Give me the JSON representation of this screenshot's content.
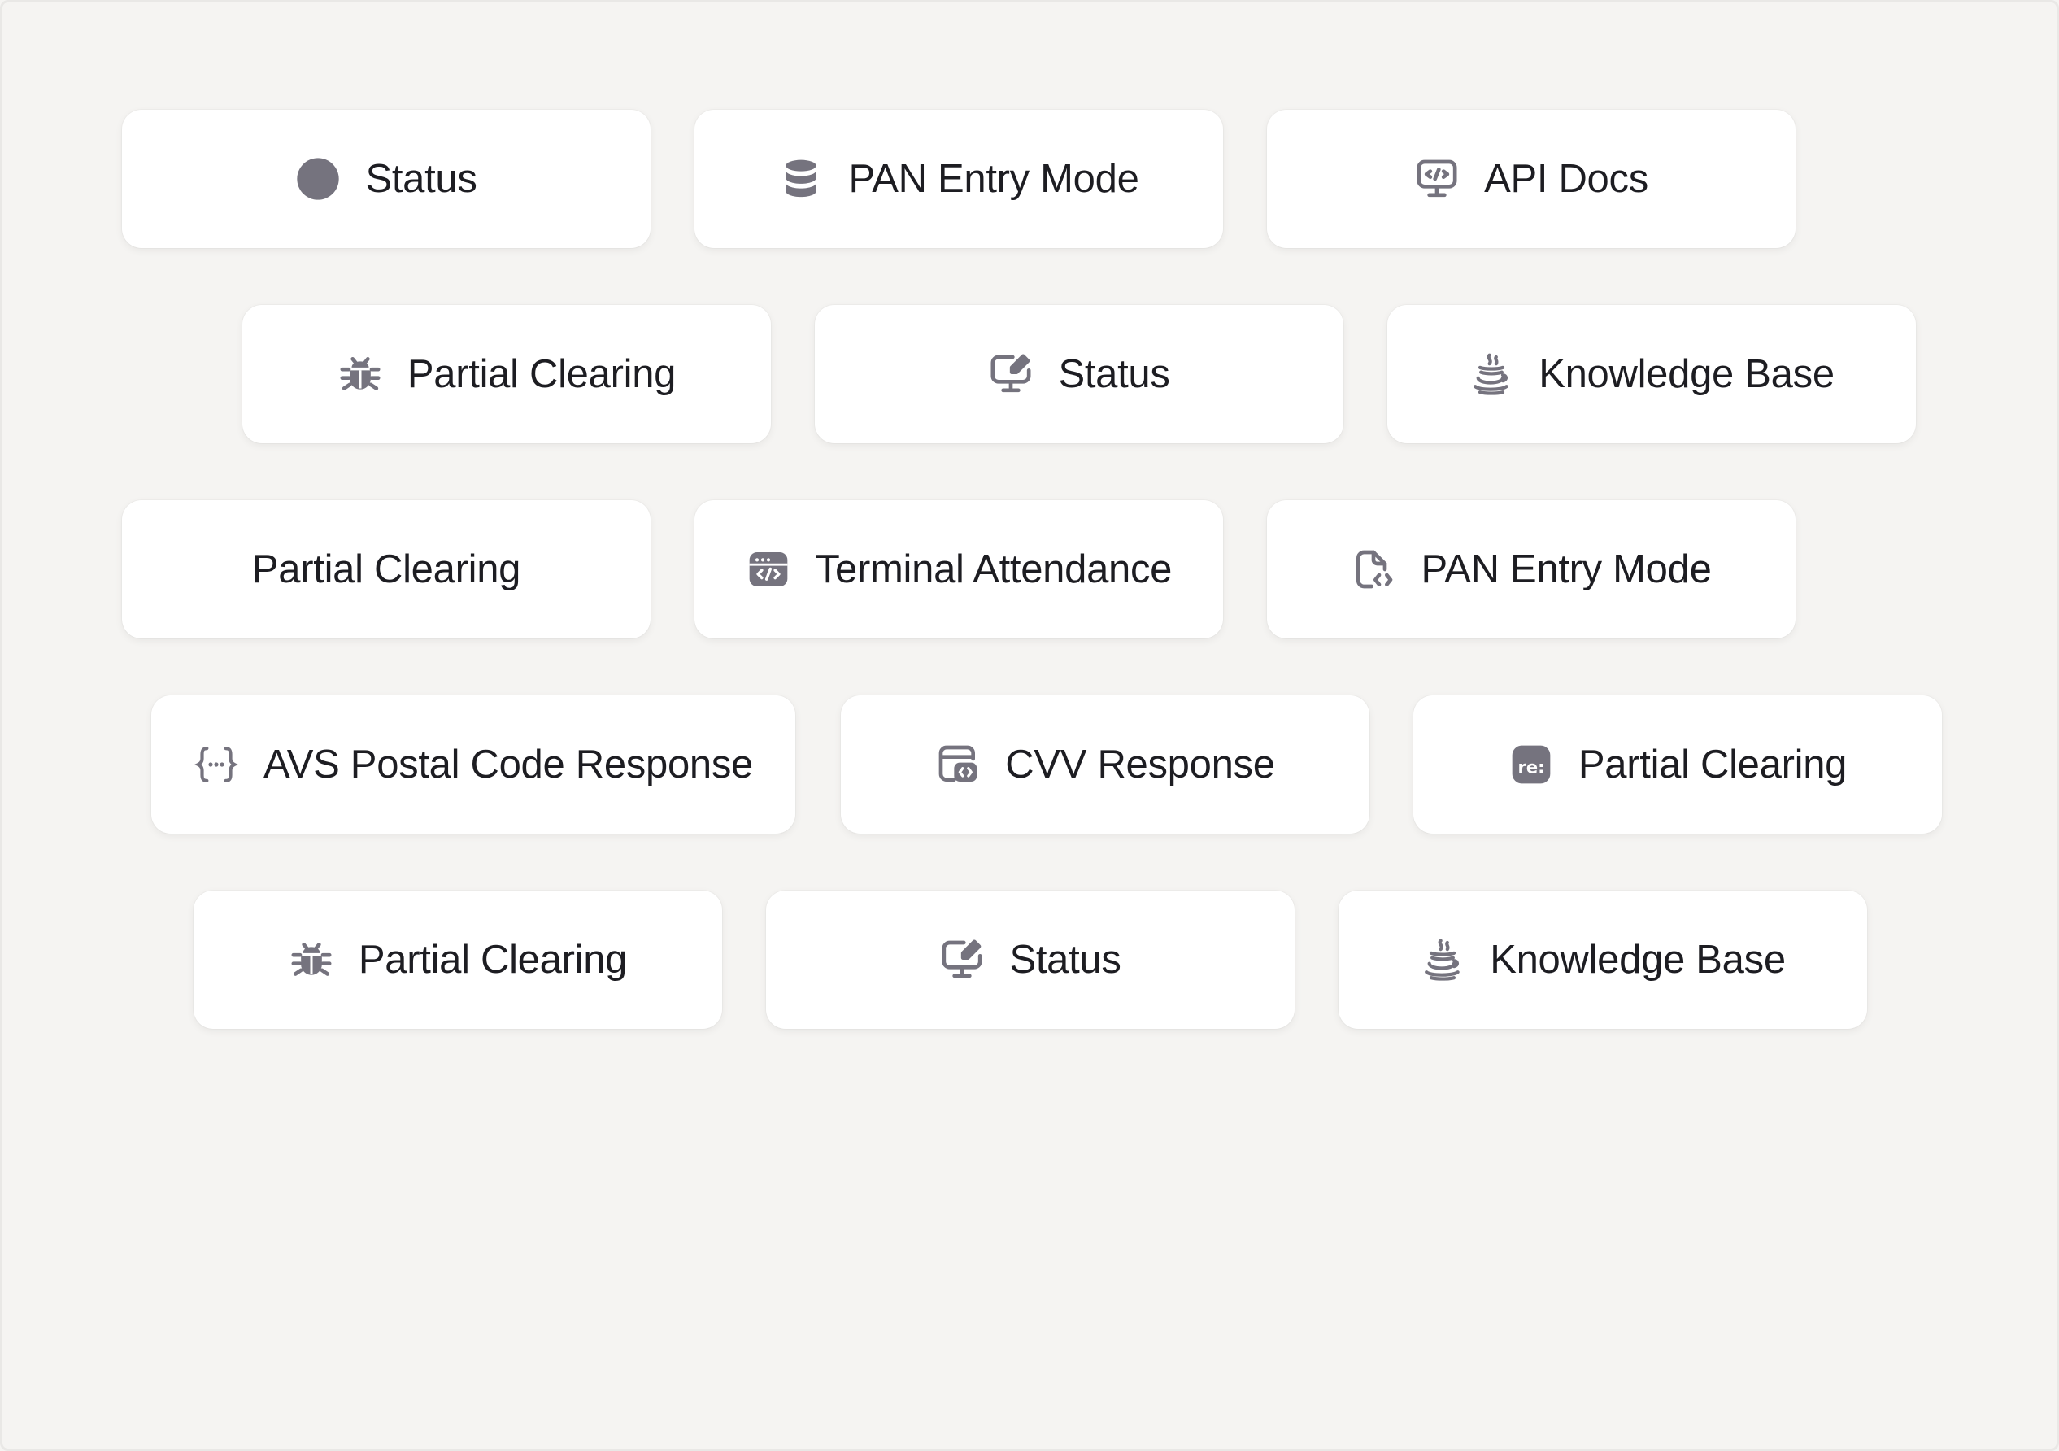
{
  "colors": {
    "background": "#f5f4f2",
    "chip": "#ffffff",
    "text": "#1d1d22",
    "icon": "#75737e"
  },
  "chips": [
    {
      "label": "Status",
      "icon": "circle-icon"
    },
    {
      "label": "PAN Entry Mode",
      "icon": "database-icon"
    },
    {
      "label": "API Docs",
      "icon": "monitor-code-icon"
    },
    {
      "label": "Partial Clearing",
      "icon": "bug-icon"
    },
    {
      "label": "Status",
      "icon": "monitor-edit-icon"
    },
    {
      "label": "Knowledge Base",
      "icon": "java-cup-icon"
    },
    {
      "label": "Partial Clearing",
      "icon": ""
    },
    {
      "label": "Terminal Attendance",
      "icon": "browser-code-icon"
    },
    {
      "label": "PAN Entry Mode",
      "icon": "file-code-icon"
    },
    {
      "label": "AVS Postal Code Response",
      "icon": "braces-dots-icon"
    },
    {
      "label": "CVV Response",
      "icon": "window-code-icon"
    },
    {
      "label": "Partial Clearing",
      "icon": "regex-icon"
    },
    {
      "label": "Partial Clearing",
      "icon": "bug-icon"
    },
    {
      "label": "Status",
      "icon": "monitor-edit-icon"
    },
    {
      "label": "Knowledge Base",
      "icon": "java-cup-icon"
    }
  ]
}
